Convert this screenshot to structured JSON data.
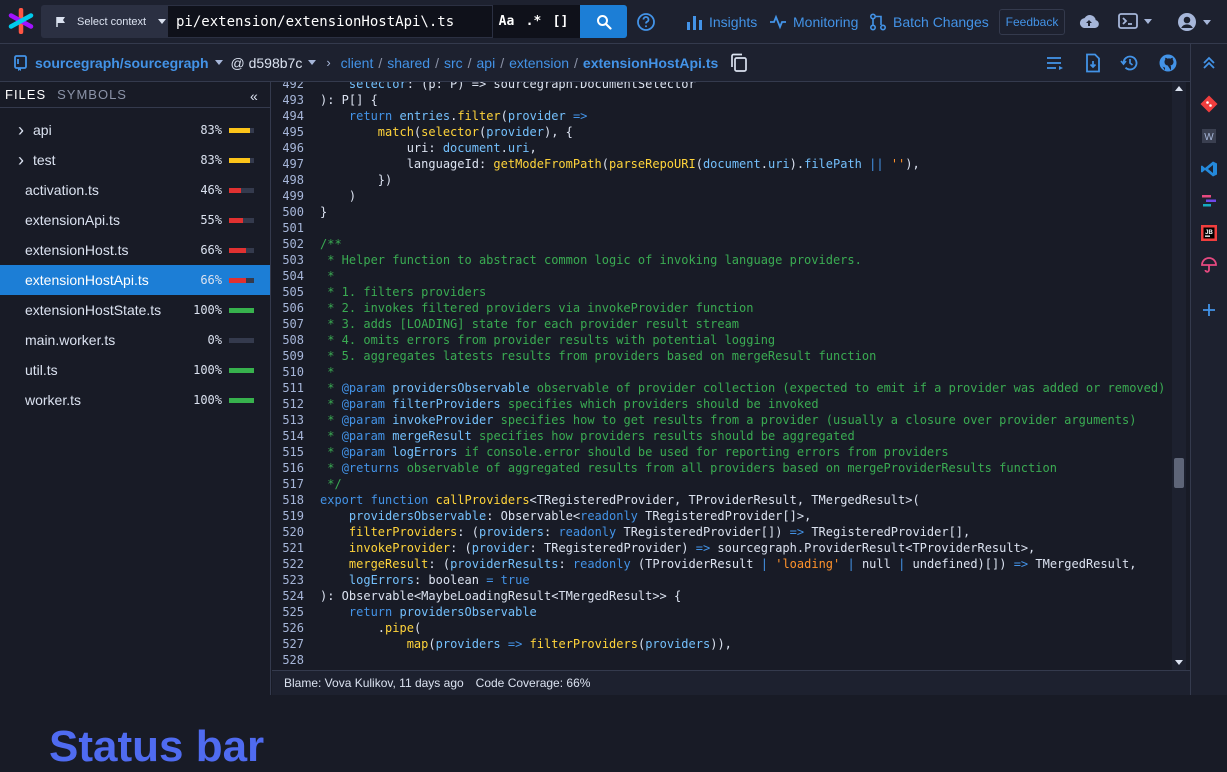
{
  "nav": {
    "context_label": "Select context",
    "search_query": "pi/extension/extensionHostApi\\.ts",
    "opt_case": "Aa",
    "opt_regex": ".*",
    "opt_structural": "[]",
    "insights": "Insights",
    "monitoring": "Monitoring",
    "batch_changes": "Batch Changes",
    "feedback": "Feedback"
  },
  "breadcrumb": {
    "repo": "sourcegraph/sourcegraph",
    "revision": "@ d598b7c",
    "path": [
      "client",
      "shared",
      "src",
      "api",
      "extension"
    ],
    "file": "extensionHostApi.ts"
  },
  "sidebar": {
    "tab_files": "FILES",
    "tab_symbols": "SYMBOLS",
    "items": [
      {
        "label": "api",
        "folder": true,
        "pct": "83%",
        "coverage": 0.83,
        "color": "#fcc419"
      },
      {
        "label": "test",
        "folder": true,
        "pct": "83%",
        "coverage": 0.83,
        "color": "#fcc419"
      },
      {
        "label": "activation.ts",
        "folder": false,
        "pct": "46%",
        "coverage": 0.46,
        "color": "#e03131"
      },
      {
        "label": "extensionApi.ts",
        "folder": false,
        "pct": "55%",
        "coverage": 0.55,
        "color": "#e03131"
      },
      {
        "label": "extensionHost.ts",
        "folder": false,
        "pct": "66%",
        "coverage": 0.66,
        "color": "#e03131"
      },
      {
        "label": "extensionHostApi.ts",
        "folder": false,
        "pct": "66%",
        "coverage": 0.66,
        "color": "#e03131",
        "selected": true
      },
      {
        "label": "extensionHostState.ts",
        "folder": false,
        "pct": "100%",
        "coverage": 1.0,
        "color": "#37b24d"
      },
      {
        "label": "main.worker.ts",
        "folder": false,
        "pct": "0%",
        "coverage": 0,
        "color": "#343a4d"
      },
      {
        "label": "util.ts",
        "folder": false,
        "pct": "100%",
        "coverage": 1.0,
        "color": "#37b24d"
      },
      {
        "label": "worker.ts",
        "folder": false,
        "pct": "100%",
        "coverage": 1.0,
        "color": "#37b24d"
      }
    ],
    "status_bar_label": "Status bar"
  },
  "code": {
    "lines": [
      {
        "n": "492",
        "seg": [
          [
            "",
            "    "
          ],
          [
            "var",
            "selector"
          ],
          [
            "",
            ": (p: P) => sourcegraph.DocumentSelector"
          ]
        ]
      },
      {
        "n": "493",
        "seg": [
          [
            "",
            "): P[] {"
          ]
        ]
      },
      {
        "n": "494",
        "seg": [
          [
            "",
            "    "
          ],
          [
            "kw",
            "return"
          ],
          [
            "",
            " "
          ],
          [
            "var",
            "entries"
          ],
          [
            "",
            "."
          ],
          [
            "fn",
            "filter"
          ],
          [
            "",
            "("
          ],
          [
            "var",
            "provider"
          ],
          [
            "",
            " "
          ],
          [
            "kw",
            "=>"
          ]
        ]
      },
      {
        "n": "495",
        "seg": [
          [
            "",
            "        "
          ],
          [
            "fn",
            "match"
          ],
          [
            "",
            "("
          ],
          [
            "fn",
            "selector"
          ],
          [
            "",
            "("
          ],
          [
            "var",
            "provider"
          ],
          [
            "",
            "), {"
          ]
        ]
      },
      {
        "n": "496",
        "seg": [
          [
            "",
            "            uri: "
          ],
          [
            "var",
            "document"
          ],
          [
            "",
            "."
          ],
          [
            "var",
            "uri"
          ],
          [
            "",
            ","
          ]
        ]
      },
      {
        "n": "497",
        "seg": [
          [
            "",
            "            languageId: "
          ],
          [
            "fn",
            "getModeFromPath"
          ],
          [
            "",
            "("
          ],
          [
            "fn",
            "parseRepoURI"
          ],
          [
            "",
            "("
          ],
          [
            "var",
            "document"
          ],
          [
            "",
            "."
          ],
          [
            "var",
            "uri"
          ],
          [
            "",
            ")."
          ],
          [
            "var",
            "filePath"
          ],
          [
            "",
            " "
          ],
          [
            "kw",
            "||"
          ],
          [
            "",
            " "
          ],
          [
            "str",
            "''"
          ],
          [
            "",
            "),"
          ]
        ]
      },
      {
        "n": "498",
        "seg": [
          [
            "",
            "        })"
          ]
        ]
      },
      {
        "n": "499",
        "seg": [
          [
            "",
            "    )"
          ]
        ]
      },
      {
        "n": "500",
        "seg": [
          [
            "",
            "}"
          ]
        ]
      },
      {
        "n": "501",
        "seg": [
          [
            "",
            ""
          ]
        ]
      },
      {
        "n": "502",
        "seg": [
          [
            "cm",
            "/**"
          ]
        ]
      },
      {
        "n": "503",
        "seg": [
          [
            "cm",
            " * Helper function to abstract common logic of invoking language providers."
          ]
        ]
      },
      {
        "n": "504",
        "seg": [
          [
            "cm",
            " *"
          ]
        ]
      },
      {
        "n": "505",
        "seg": [
          [
            "cm",
            " * 1. filters providers"
          ]
        ]
      },
      {
        "n": "506",
        "seg": [
          [
            "cm",
            " * 2. invokes filtered providers via invokeProvider function"
          ]
        ]
      },
      {
        "n": "507",
        "seg": [
          [
            "cm",
            " * 3. adds [LOADING] state for each provider result stream"
          ]
        ]
      },
      {
        "n": "508",
        "seg": [
          [
            "cm",
            " * 4. omits errors from provider results with potential logging"
          ]
        ]
      },
      {
        "n": "509",
        "seg": [
          [
            "cm",
            " * 5. aggregates latests results from providers based on mergeResult function"
          ]
        ]
      },
      {
        "n": "510",
        "seg": [
          [
            "cm",
            " *"
          ]
        ]
      },
      {
        "n": "511",
        "seg": [
          [
            "cm",
            " * "
          ],
          [
            "kw",
            "@param"
          ],
          [
            "",
            " "
          ],
          [
            "var",
            "providersObservable"
          ],
          [
            "cm",
            " observable of provider collection (expected to emit if a provider was added or removed)"
          ]
        ]
      },
      {
        "n": "512",
        "seg": [
          [
            "cm",
            " * "
          ],
          [
            "kw",
            "@param"
          ],
          [
            "",
            " "
          ],
          [
            "var",
            "filterProviders"
          ],
          [
            "cm",
            " specifies which providers should be invoked"
          ]
        ]
      },
      {
        "n": "513",
        "seg": [
          [
            "cm",
            " * "
          ],
          [
            "kw",
            "@param"
          ],
          [
            "",
            " "
          ],
          [
            "var",
            "invokeProvider"
          ],
          [
            "cm",
            " specifies how to get results from a provider (usually a closure over provider arguments)"
          ]
        ]
      },
      {
        "n": "514",
        "seg": [
          [
            "cm",
            " * "
          ],
          [
            "kw",
            "@param"
          ],
          [
            "",
            " "
          ],
          [
            "var",
            "mergeResult"
          ],
          [
            "cm",
            " specifies how providers results should be aggregated"
          ]
        ]
      },
      {
        "n": "515",
        "seg": [
          [
            "cm",
            " * "
          ],
          [
            "kw",
            "@param"
          ],
          [
            "",
            " "
          ],
          [
            "var",
            "logErrors"
          ],
          [
            "cm",
            " if console.error should be used for reporting errors from providers"
          ]
        ]
      },
      {
        "n": "516",
        "seg": [
          [
            "cm",
            " * "
          ],
          [
            "kw",
            "@returns"
          ],
          [
            "cm",
            " observable of aggregated results from all providers based on mergeProviderResults function"
          ]
        ]
      },
      {
        "n": "517",
        "seg": [
          [
            "cm",
            " */"
          ]
        ]
      },
      {
        "n": "518",
        "seg": [
          [
            "kw",
            "export"
          ],
          [
            "",
            " "
          ],
          [
            "kw",
            "function"
          ],
          [
            "",
            " "
          ],
          [
            "fn",
            "callProviders"
          ],
          [
            "",
            "<TRegisteredProvider, TProviderResult, TMergedResult>("
          ]
        ]
      },
      {
        "n": "519",
        "seg": [
          [
            "",
            "    "
          ],
          [
            "var",
            "providersObservable"
          ],
          [
            "",
            ": Observable<"
          ],
          [
            "kw",
            "readonly"
          ],
          [
            "",
            " TRegisteredProvider[]>,"
          ]
        ]
      },
      {
        "n": "520",
        "seg": [
          [
            "",
            "    "
          ],
          [
            "fn",
            "filterProviders"
          ],
          [
            "",
            ": ("
          ],
          [
            "var",
            "providers"
          ],
          [
            "",
            ": "
          ],
          [
            "kw",
            "readonly"
          ],
          [
            "",
            " TRegisteredProvider[]) "
          ],
          [
            "kw",
            "=>"
          ],
          [
            "",
            " TRegisteredProvider[],"
          ]
        ]
      },
      {
        "n": "521",
        "seg": [
          [
            "",
            "    "
          ],
          [
            "fn",
            "invokeProvider"
          ],
          [
            "",
            ": ("
          ],
          [
            "var",
            "provider"
          ],
          [
            "",
            ": TRegisteredProvider) "
          ],
          [
            "kw",
            "=>"
          ],
          [
            "",
            " sourcegraph.ProviderResult<TProviderResult>,"
          ]
        ]
      },
      {
        "n": "522",
        "seg": [
          [
            "",
            "    "
          ],
          [
            "fn",
            "mergeResult"
          ],
          [
            "",
            ": ("
          ],
          [
            "var",
            "providerResults"
          ],
          [
            "",
            ": "
          ],
          [
            "kw",
            "readonly"
          ],
          [
            "",
            " (TProviderResult "
          ],
          [
            "kw",
            "|"
          ],
          [
            "",
            " "
          ],
          [
            "str",
            "'loading'"
          ],
          [
            "",
            " "
          ],
          [
            "kw",
            "|"
          ],
          [
            "",
            " null "
          ],
          [
            "kw",
            "|"
          ],
          [
            "",
            " undefined)[]) "
          ],
          [
            "kw",
            "=>"
          ],
          [
            "",
            " TMergedResult,"
          ]
        ]
      },
      {
        "n": "523",
        "seg": [
          [
            "",
            "    "
          ],
          [
            "var",
            "logErrors"
          ],
          [
            "",
            ": boolean "
          ],
          [
            "kw",
            "="
          ],
          [
            "",
            " "
          ],
          [
            "kw",
            "true"
          ]
        ]
      },
      {
        "n": "524",
        "seg": [
          [
            "",
            "): Observable<MaybeLoadingResult<TMergedResult>> {"
          ]
        ]
      },
      {
        "n": "525",
        "seg": [
          [
            "",
            "    "
          ],
          [
            "kw",
            "return"
          ],
          [
            "",
            " "
          ],
          [
            "var",
            "providersObservable"
          ]
        ]
      },
      {
        "n": "526",
        "seg": [
          [
            "",
            "        ."
          ],
          [
            "fn",
            "pipe"
          ],
          [
            "",
            "("
          ]
        ]
      },
      {
        "n": "527",
        "seg": [
          [
            "",
            "            "
          ],
          [
            "fn",
            "map"
          ],
          [
            "",
            "("
          ],
          [
            "var",
            "providers"
          ],
          [
            "",
            " "
          ],
          [
            "kw",
            "=>"
          ],
          [
            "",
            " "
          ],
          [
            "fn",
            "filterProviders"
          ],
          [
            "",
            "("
          ],
          [
            "var",
            "providers"
          ],
          [
            "",
            ")),"
          ]
        ]
      },
      {
        "n": "528",
        "seg": [
          [
            "",
            ""
          ]
        ]
      }
    ]
  },
  "bottombar": {
    "blame": "Blame: Vova Kulikov, 11 days ago",
    "coverage": "Code Coverage: 66%"
  },
  "colors": {
    "accent": "#1c7ed6",
    "link": "#4393e7",
    "status_bar_label": "#4f6bf0"
  }
}
